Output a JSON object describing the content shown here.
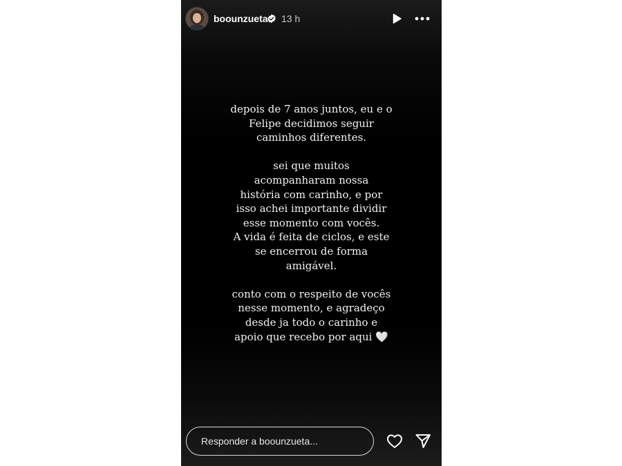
{
  "header": {
    "username": "boounzueta",
    "verified": true,
    "time_ago": "13 h",
    "icons": {
      "avatar": "profile-photo",
      "verified": "verified-badge-icon",
      "play": "play-icon",
      "more": "more-options-icon"
    }
  },
  "story": {
    "paragraph1": [
      "depois de 7 anos juntos, eu e o",
      "Felipe decidimos seguir",
      "caminhos diferentes."
    ],
    "paragraph2": [
      "sei que muitos",
      "acompanharam nossa",
      "história com carinho, e por",
      "isso achei importante dividir",
      "esse momento com vocês.",
      "A vida é feita de ciclos, e este",
      "se encerrou de forma",
      "amigável."
    ],
    "paragraph3": [
      "conto com o respeito de vocês",
      "nesse momento, e agradeço",
      "desde ja todo o carinho e",
      "apoio que recebo por aqui 🤍"
    ]
  },
  "footer": {
    "reply_placeholder": "Responder a boounzueta...",
    "icons": {
      "like": "heart-icon",
      "share": "send-icon"
    }
  },
  "colors": {
    "background": "#000000",
    "text": "#ffffff",
    "page": "#ffffff"
  }
}
